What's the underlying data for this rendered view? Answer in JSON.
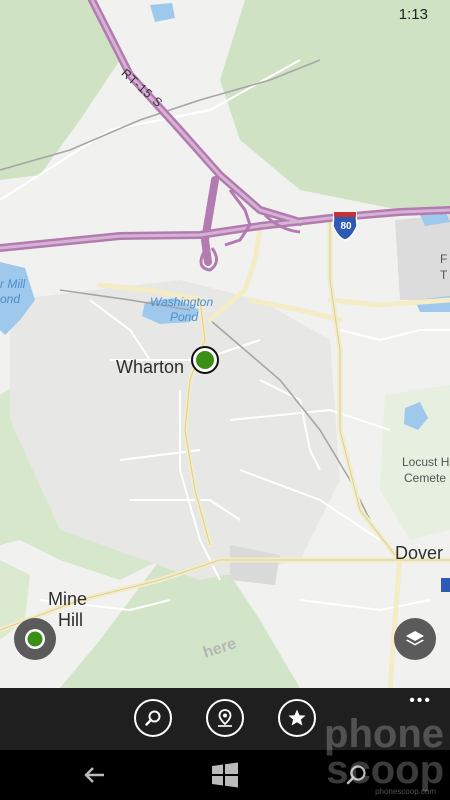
{
  "status_bar": {
    "time": "1:13"
  },
  "map": {
    "places": {
      "wharton": "Wharton",
      "dover": "Dover",
      "mine_hill_line1": "Mine",
      "mine_hill_line2": "Hill",
      "locust_hill_line1": "Locust Hi",
      "locust_hill_line2": "Cemete",
      "f_fragment": "F",
      "t_fragment": "T"
    },
    "water": {
      "washington_pond_line1": "Washington",
      "washington_pond_line2": "Pond",
      "mill_pond_line1": "r Mill",
      "mill_pond_line2": "ond"
    },
    "roads": {
      "rt15": "RT-15 S",
      "i80": "80"
    },
    "brand": "here"
  },
  "app_bar": {
    "buttons": [
      "search",
      "directions",
      "favorites"
    ],
    "more": "•••"
  },
  "nav_bar": [
    "back",
    "start",
    "search"
  ],
  "watermark": {
    "line1": "phone",
    "line2": "scoop",
    "url": "phonescoop.com"
  },
  "colors": {
    "map_bg": "#f1f1ef",
    "green_area": "#cfe3c4",
    "highway": "#b37bb0",
    "water": "#9ec8ec",
    "location": "#3b8f17",
    "appbar": "#1f1f1f"
  }
}
